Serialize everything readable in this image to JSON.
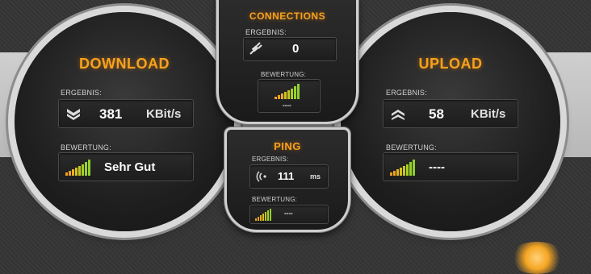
{
  "download": {
    "title": "DOWNLOAD",
    "result_label": "ERGEBNIS:",
    "value": "381",
    "unit": "KBit/s",
    "rating_label": "BEWERTUNG:",
    "rating_text": "Sehr Gut",
    "icon": "chevron-down-icon"
  },
  "upload": {
    "title": "UPLOAD",
    "result_label": "ERGEBNIS:",
    "value": "58",
    "unit": "KBit/s",
    "rating_label": "BEWERTUNG:",
    "rating_text": "----",
    "icon": "chevron-up-icon"
  },
  "connections": {
    "title": "CONNECTIONS",
    "result_label": "ERGEBNIS:",
    "value": "0",
    "rating_label": "BEWERTUNG:",
    "rating_text": "----",
    "icon": "plug-icon"
  },
  "ping": {
    "title": "PING",
    "result_label": "ERGEBNIS:",
    "value": "111",
    "unit": "ms",
    "rating_label": "BEWERTUNG:",
    "rating_text": "----",
    "icon": "signal-waves-icon"
  },
  "colors": {
    "accent": "#f7a21c",
    "bar_low": "#f0a020",
    "bar_high": "#8fd12a"
  }
}
